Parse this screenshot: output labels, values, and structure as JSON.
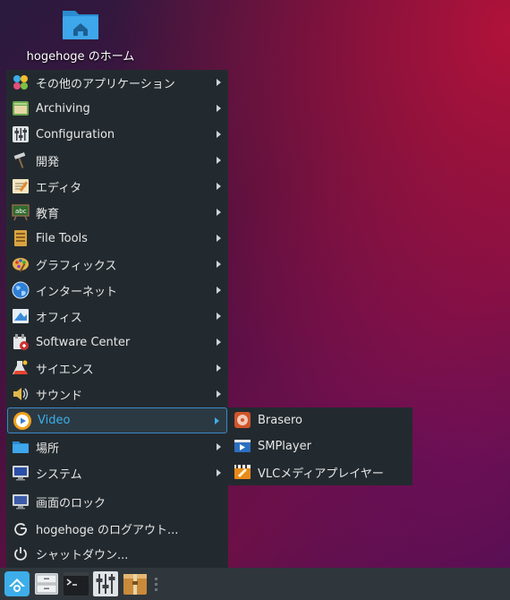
{
  "desktop": {
    "home_icon": {
      "label": "hogehoge のホーム",
      "icon": "home-folder-icon"
    }
  },
  "menu": {
    "categories": [
      {
        "label": "その他のアプリケーション",
        "icon": "other-apps-icon",
        "has_submenu": true
      },
      {
        "label": "Archiving",
        "icon": "archive-icon",
        "has_submenu": true
      },
      {
        "label": "Configuration",
        "icon": "settings-sliders-icon",
        "has_submenu": true
      },
      {
        "label": "開発",
        "icon": "hammer-icon",
        "has_submenu": true
      },
      {
        "label": "エディタ",
        "icon": "text-editor-icon",
        "has_submenu": true
      },
      {
        "label": "教育",
        "icon": "chalkboard-icon",
        "has_submenu": true
      },
      {
        "label": "File Tools",
        "icon": "file-tools-icon",
        "has_submenu": true
      },
      {
        "label": "グラフィックス",
        "icon": "palette-icon",
        "has_submenu": true
      },
      {
        "label": "インターネット",
        "icon": "globe-icon",
        "has_submenu": true
      },
      {
        "label": "オフィス",
        "icon": "office-icon",
        "has_submenu": true
      },
      {
        "label": "Software Center",
        "icon": "software-center-icon",
        "has_submenu": true
      },
      {
        "label": "サイエンス",
        "icon": "flask-icon",
        "has_submenu": true
      },
      {
        "label": "サウンド",
        "icon": "speaker-icon",
        "has_submenu": true
      },
      {
        "label": "Video",
        "icon": "video-play-icon",
        "has_submenu": true,
        "active": true
      },
      {
        "label": "場所",
        "icon": "folder-icon",
        "has_submenu": true
      },
      {
        "label": "システム",
        "icon": "monitor-icon",
        "has_submenu": true
      }
    ],
    "actions": [
      {
        "label": "画面のロック",
        "icon": "lock-screen-icon"
      },
      {
        "label": "hogehoge のログアウト...",
        "icon": "logout-icon"
      },
      {
        "label": "シャットダウン...",
        "icon": "power-icon"
      }
    ]
  },
  "video_submenu": {
    "items": [
      {
        "label": "Brasero",
        "icon": "brasero-icon"
      },
      {
        "label": "SMPlayer",
        "icon": "smplayer-icon"
      },
      {
        "label": "VLCメディアプレイヤー",
        "icon": "vlc-icon"
      }
    ]
  },
  "taskbar": {
    "items": [
      {
        "icon": "app-menu-icon"
      },
      {
        "icon": "file-manager-icon"
      },
      {
        "icon": "terminal-icon"
      },
      {
        "icon": "settings-sliders-icon"
      },
      {
        "icon": "archive-manager-icon"
      }
    ]
  },
  "colors": {
    "accent": "#3daee9",
    "menu_bg": "#232a2f",
    "taskbar_bg": "#30373c"
  }
}
